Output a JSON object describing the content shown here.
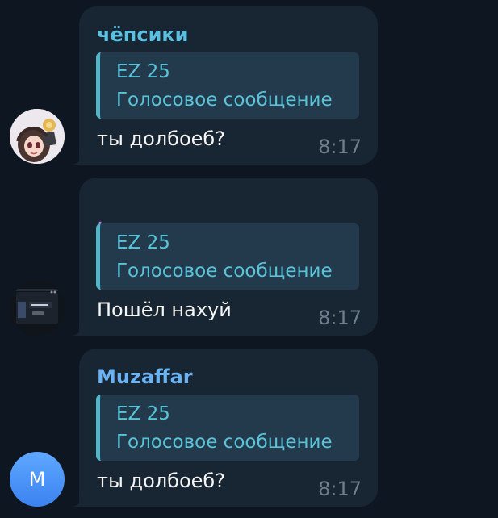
{
  "messages": [
    {
      "sender": "чёпсики",
      "sender_color": "#5bc0e0",
      "reply_title": "EZ 25",
      "reply_subtitle": "Голосовое сообщение",
      "text": "ты долбоеб?",
      "time": "8:17",
      "avatar_icon": "anime-avatar"
    },
    {
      "sender": ".",
      "sender_color": "#b57bee",
      "reply_title": "EZ 25",
      "reply_subtitle": "Голосовое сообщение",
      "text": "Пошёл нахуй",
      "time": "8:17",
      "avatar_icon": "game-screenshot-avatar"
    },
    {
      "sender": "Muzaffar",
      "sender_color": "#6ab2f2",
      "reply_title": "EZ 25",
      "reply_subtitle": "Голосовое сообщение",
      "text": "ты долбоеб?",
      "time": "8:17",
      "avatar_letter": "M"
    }
  ],
  "colors": {
    "background": "#0e1621",
    "bubble": "#182533",
    "reply_bg": "#223a4b",
    "reply_accent": "#52b6c9",
    "time": "#6d7f8f"
  }
}
